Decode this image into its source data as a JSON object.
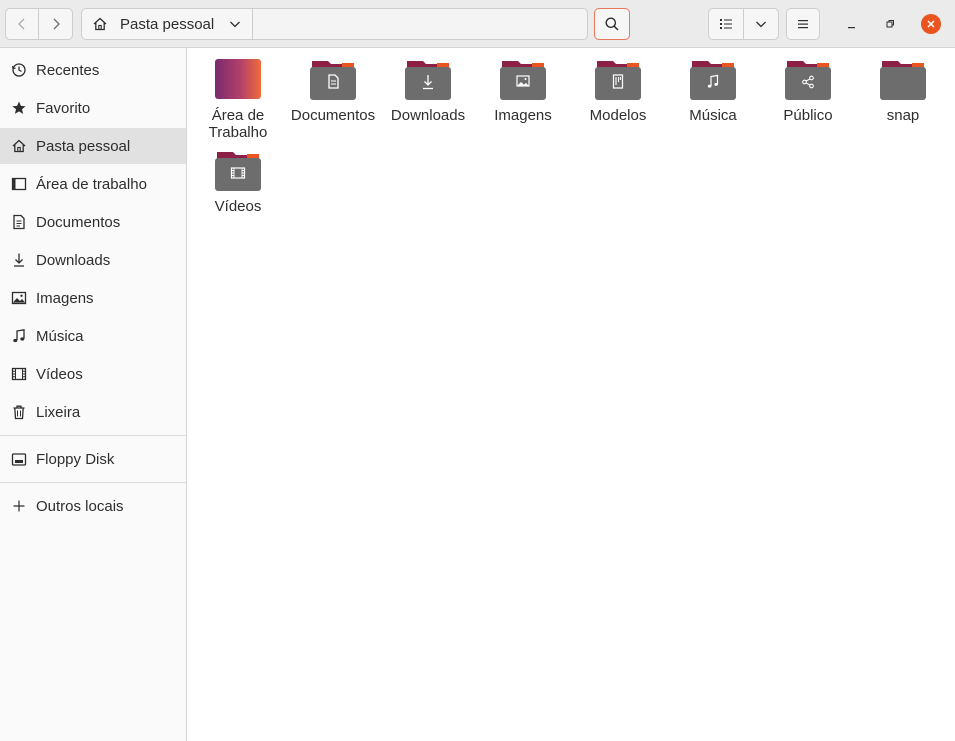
{
  "window": {
    "location": "Pasta pessoal"
  },
  "sidebar": {
    "items": [
      {
        "label": "Recentes",
        "icon": "clock-icon"
      },
      {
        "label": "Favorito",
        "icon": "star-icon"
      },
      {
        "label": "Pasta pessoal",
        "icon": "home-icon",
        "active": true
      },
      {
        "label": "Área de trabalho",
        "icon": "desktop-icon"
      },
      {
        "label": "Documentos",
        "icon": "document-icon"
      },
      {
        "label": "Downloads",
        "icon": "download-icon"
      },
      {
        "label": "Imagens",
        "icon": "image-icon"
      },
      {
        "label": "Música",
        "icon": "music-icon"
      },
      {
        "label": "Vídeos",
        "icon": "video-icon"
      },
      {
        "label": "Lixeira",
        "icon": "trash-icon"
      }
    ],
    "devices": [
      {
        "label": "Floppy Disk",
        "icon": "floppy-disk-icon"
      }
    ],
    "other": [
      {
        "label": "Outros locais",
        "icon": "plus-icon"
      }
    ]
  },
  "files": [
    {
      "label": "Área de Trabalho",
      "icon": "desktop-folder-icon"
    },
    {
      "label": "Documentos",
      "icon": "documents-folder-icon"
    },
    {
      "label": "Downloads",
      "icon": "downloads-folder-icon"
    },
    {
      "label": "Imagens",
      "icon": "pictures-folder-icon"
    },
    {
      "label": "Modelos",
      "icon": "templates-folder-icon"
    },
    {
      "label": "Música",
      "icon": "music-folder-icon"
    },
    {
      "label": "Público",
      "icon": "public-folder-icon"
    },
    {
      "label": "snap",
      "icon": "folder-icon"
    },
    {
      "label": "Vídeos",
      "icon": "videos-folder-icon"
    }
  ],
  "colors": {
    "accent": "#e95420",
    "folder_tab": "#8c2047",
    "folder_body": "#6d6d6d"
  }
}
